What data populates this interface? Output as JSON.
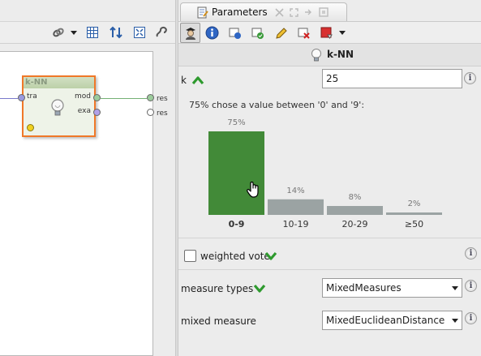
{
  "parameters_tab": {
    "title": "Parameters"
  },
  "operator_box": {
    "name": "k-NN",
    "input_port": "tra",
    "output_ports": [
      "mod",
      "exa"
    ],
    "result_ports": [
      "res",
      "res"
    ]
  },
  "operator_header": {
    "name": "k-NN"
  },
  "param_k": {
    "label": "k",
    "value": "25"
  },
  "recommendation": {
    "caption": "75% chose a value between '0' and '9':"
  },
  "chart_data": {
    "type": "bar",
    "categories": [
      "0-9",
      "10-19",
      "20-29",
      "≥50"
    ],
    "values": [
      75,
      14,
      8,
      2
    ],
    "value_labels": [
      "75%",
      "14%",
      "8%",
      "2%"
    ],
    "highlighted_category": "0-9",
    "colors": {
      "highlight": "#428a38",
      "default": "#9ba3a3",
      "highlight_label": "#3e9a32"
    }
  },
  "param_weighted_vote": {
    "label": "weighted vote",
    "checked": false
  },
  "param_measure_types": {
    "label": "measure types",
    "value": "MixedMeasures"
  },
  "param_mixed_measure": {
    "label": "mixed measure",
    "value": "MixedEuclideanDistance"
  },
  "info_glyph": "i",
  "colors": {
    "accent_orange": "#f07828",
    "recommend_green": "#2e9a2e"
  }
}
